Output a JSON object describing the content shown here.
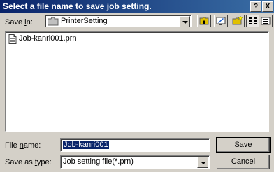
{
  "window": {
    "title": "Select a file name to save job setting.",
    "help_button": "?",
    "close_button": "X"
  },
  "save_in": {
    "label_pre": "Save ",
    "label_u": "i",
    "label_post": "n:",
    "value": "PrinterSetting"
  },
  "files": [
    {
      "name": "Job-kanri001.prn"
    }
  ],
  "file_name": {
    "label_pre": "File ",
    "label_u": "n",
    "label_post": "ame:",
    "value": "Job-kanri001"
  },
  "save_type": {
    "label_pre": "Save as ",
    "label_u": "t",
    "label_post": "ype:",
    "value": "Job setting file(*.prn)"
  },
  "buttons": {
    "save_u": "S",
    "save_rest": "ave",
    "cancel": "Cancel"
  }
}
